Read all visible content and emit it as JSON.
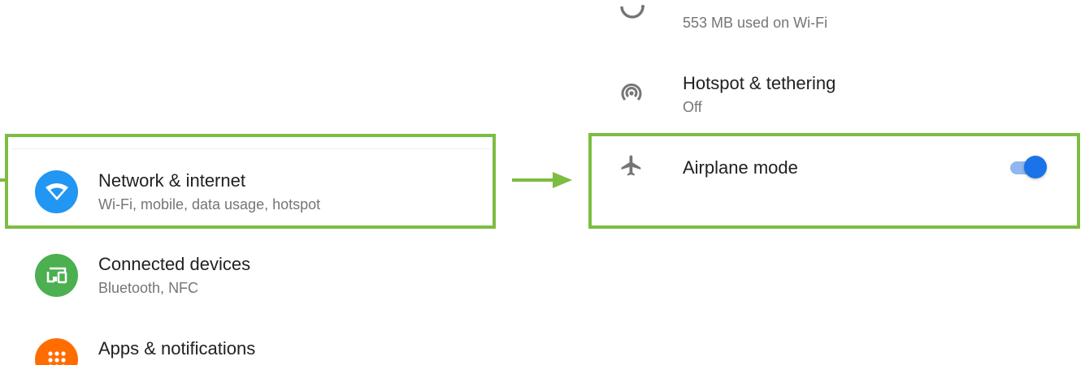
{
  "left": {
    "items": [
      {
        "title": "Network & internet",
        "subtitle": "Wi-Fi, mobile, data usage, hotspot",
        "icon": "wifi-icon",
        "color": "#2196f3"
      },
      {
        "title": "Connected devices",
        "subtitle": "Bluetooth, NFC",
        "icon": "devices-icon",
        "color": "#4caf50"
      },
      {
        "title": "Apps & notifications",
        "subtitle": "",
        "icon": "apps-icon",
        "color": "#ff6d00"
      }
    ]
  },
  "right": {
    "data_usage": {
      "subtitle": "553 MB used on Wi-Fi",
      "icon": "data-usage-icon"
    },
    "hotspot": {
      "title": "Hotspot & tethering",
      "subtitle": "Off",
      "icon": "hotspot-icon"
    },
    "airplane": {
      "title": "Airplane mode",
      "icon": "airplane-icon",
      "enabled": true
    }
  },
  "colors": {
    "highlight": "#7cbd42",
    "accent": "#1a73e8"
  }
}
